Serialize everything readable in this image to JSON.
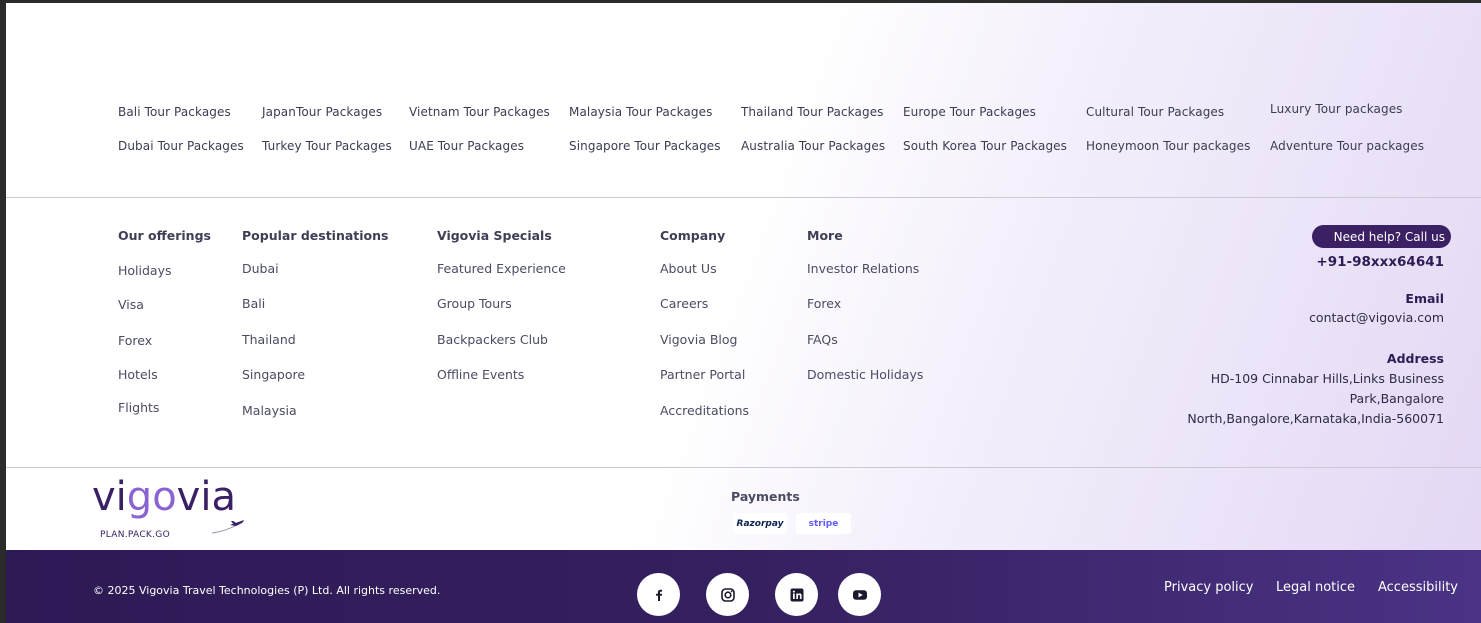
{
  "tour_packages": {
    "row1": [
      "Bali Tour Packages",
      "JapanTour Packages",
      "Vietnam Tour Packages",
      "Malaysia Tour Packages",
      "Thailand Tour Packages",
      "Europe Tour Packages",
      "Cultural Tour Packages",
      "Luxury Tour packages"
    ],
    "row2": [
      "Dubai Tour Packages",
      "Turkey Tour Packages",
      "UAE Tour Packages",
      "Singapore Tour Packages",
      "Australia Tour Packages",
      "South Korea Tour Packages",
      "Honeymoon Tour packages",
      "Adventure Tour packages"
    ]
  },
  "offerings": {
    "heading": "Our offerings",
    "items": [
      "Holidays",
      "Visa",
      "Forex",
      "Hotels",
      "Flights"
    ]
  },
  "destinations": {
    "heading": "Popular destinations",
    "items": [
      "Dubai",
      "Bali",
      "Thailand",
      "Singapore",
      "Malaysia"
    ]
  },
  "specials": {
    "heading": "Vigovia Specials",
    "items": [
      "Featured Experience",
      "Group Tours",
      "Backpackers Club",
      "Offline Events"
    ]
  },
  "company": {
    "heading": "Company",
    "items": [
      "About Us",
      "Careers",
      "Vigovia Blog",
      "Partner Portal",
      "Accreditations"
    ]
  },
  "more": {
    "heading": "More",
    "items": [
      "Investor Relations",
      "Forex",
      "FAQs",
      "Domestic Holidays"
    ]
  },
  "contact": {
    "help_label": "Need help? Call us",
    "phone": "+91-98xxx64641",
    "email_label": "Email",
    "email": "contact@vigovia.com",
    "address_label": "Address",
    "address_lines": [
      "HD-109 Cinnabar Hills,Links Business",
      "Park,Bangalore",
      "North,Bangalore,Karnataka,India-560071"
    ]
  },
  "logo": {
    "text_a": "vi",
    "text_go": "go",
    "text_b": "via",
    "tagline": "PLAN.PACK.GO"
  },
  "payments": {
    "label": "Payments",
    "razorpay": "Razorpay",
    "stripe": "stripe"
  },
  "footer": {
    "copyright": "© 2025 Vigovia Travel Technologies (P) Ltd. All rights reserved.",
    "links": [
      "Privacy policy",
      "Legal notice",
      "Accessibility"
    ],
    "social": [
      "facebook-icon",
      "instagram-icon",
      "linkedin-icon",
      "youtube-icon"
    ]
  },
  "colors": {
    "brand_dark": "#3b2063",
    "brand_accent": "#8a63d2",
    "bottom_bar": "#2d1a55"
  }
}
